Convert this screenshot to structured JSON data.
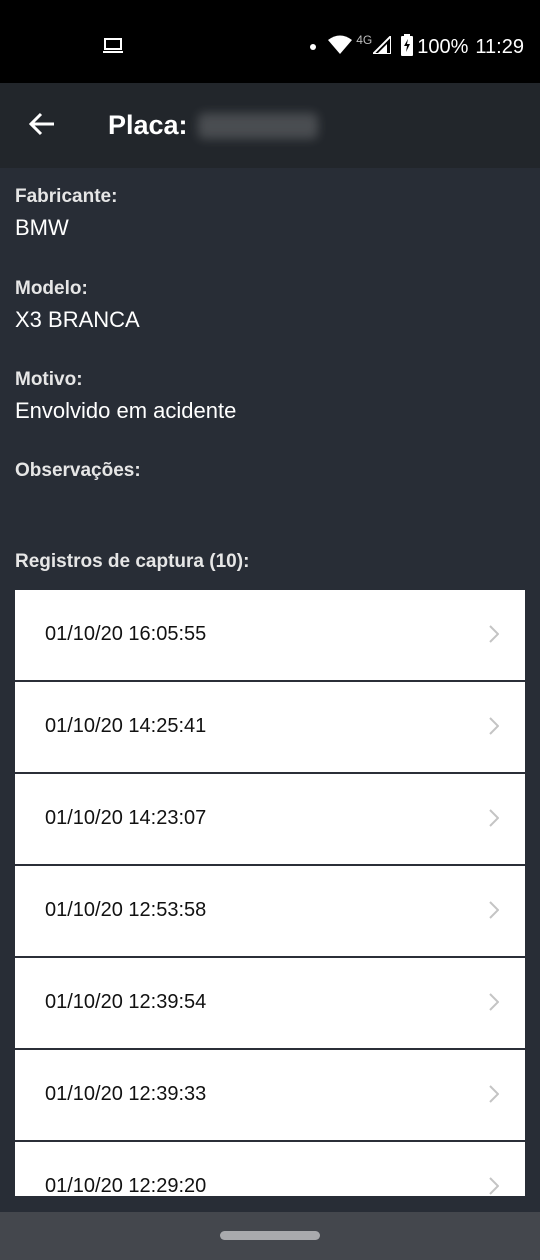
{
  "status_bar": {
    "network": "4G",
    "battery": "100%",
    "time": "11:29"
  },
  "header": {
    "title": "Placa:"
  },
  "vehicle": {
    "manufacturer_label": "Fabricante:",
    "manufacturer": "BMW",
    "model_label": "Modelo:",
    "model": "X3 BRANCA",
    "reason_label": "Motivo:",
    "reason": "Envolvido em acidente",
    "notes_label": "Observações:",
    "notes": ""
  },
  "records": {
    "label": "Registros de captura (10):",
    "items": [
      {
        "datetime": "01/10/20 16:05:55"
      },
      {
        "datetime": "01/10/20 14:25:41"
      },
      {
        "datetime": "01/10/20 14:23:07"
      },
      {
        "datetime": "01/10/20 12:53:58"
      },
      {
        "datetime": "01/10/20 12:39:54"
      },
      {
        "datetime": "01/10/20 12:39:33"
      },
      {
        "datetime": "01/10/20 12:29:20"
      }
    ]
  }
}
